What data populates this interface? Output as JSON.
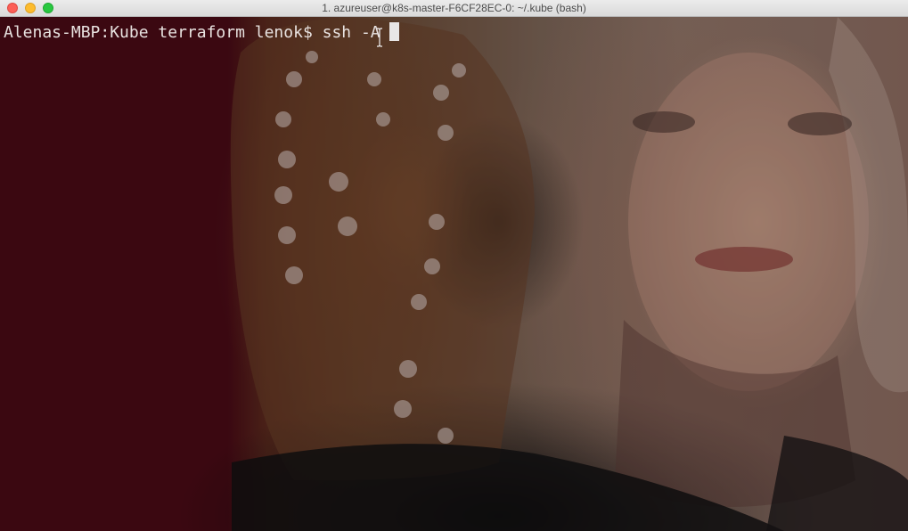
{
  "window": {
    "title": "1. azureuser@k8s-master-F6CF28EC-0: ~/.kube (bash)"
  },
  "terminal": {
    "prompt": "Alenas-MBP:Kube terraform lenok$ ",
    "command": "ssh -A"
  },
  "colors": {
    "background_left": "#480a15",
    "text": "#e8e2e0",
    "cursor": "#e8e6e6"
  },
  "icons": {
    "mouse_pointer": "text-ibeam-icon"
  }
}
